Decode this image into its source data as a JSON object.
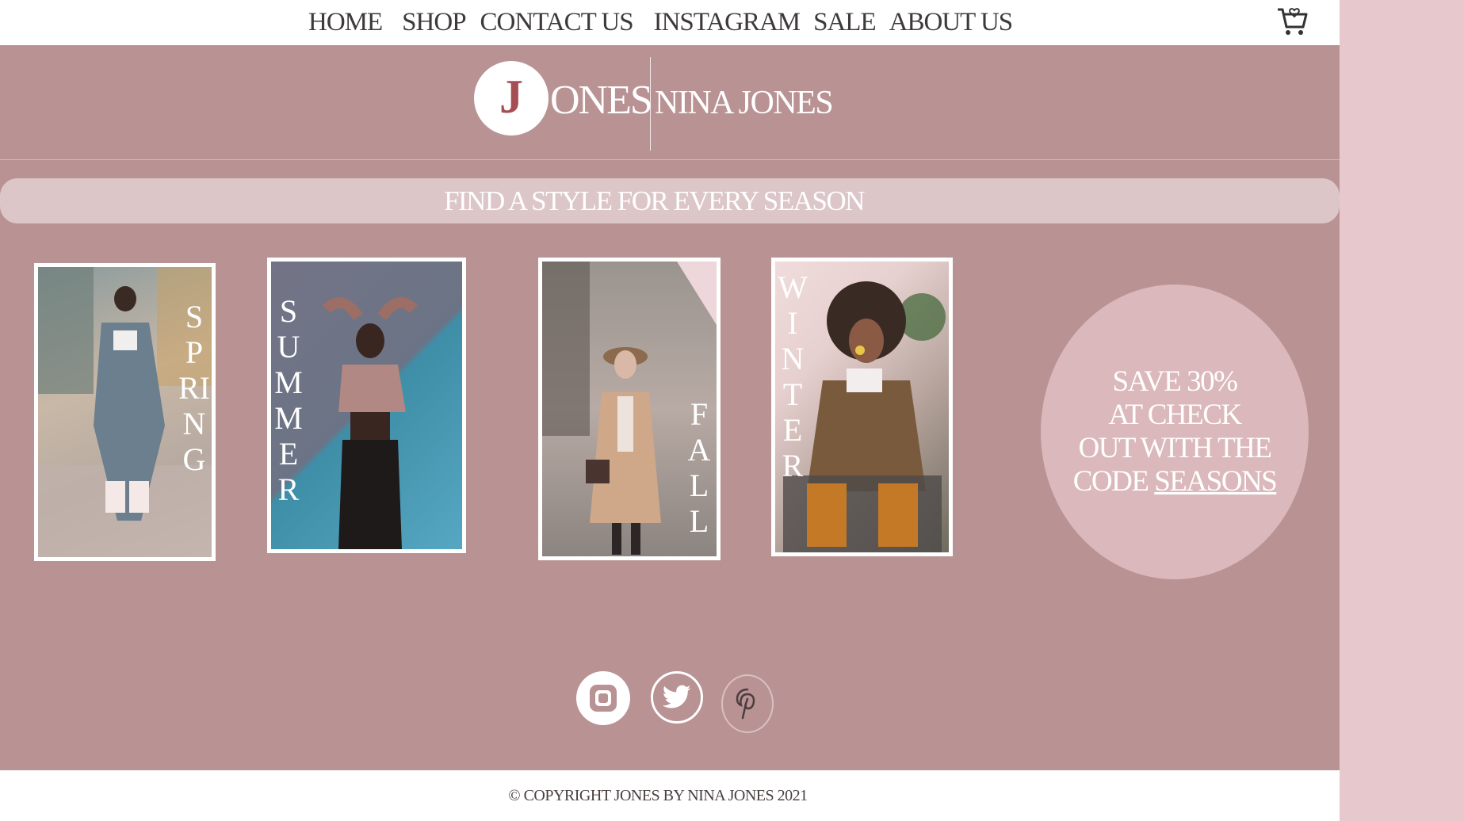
{
  "nav": {
    "items": [
      {
        "label": "HOME"
      },
      {
        "label": "SHOP"
      },
      {
        "label": "CONTACT US"
      },
      {
        "label": "INSTAGRAM"
      },
      {
        "label": "SALE"
      },
      {
        "label": "ABOUT US"
      }
    ],
    "cart_icon": "shopping-cart-icon"
  },
  "header": {
    "logo_letter": "J",
    "logo_word": "ONES",
    "brand_name": "NINA JONES"
  },
  "banner": {
    "text": "FIND A STYLE FOR EVERY SEASON"
  },
  "seasons": [
    {
      "label": "SPRING"
    },
    {
      "label": "SUMMER"
    },
    {
      "label": "FALL"
    },
    {
      "label": "WINTER"
    }
  ],
  "promo": {
    "line1": "SAVE 30%",
    "line2": "AT CHECK",
    "line3": "OUT WITH THE",
    "line4": "CODE ",
    "code": "SEASONS"
  },
  "social": [
    {
      "icon": "instagram-icon"
    },
    {
      "icon": "twitter-icon"
    },
    {
      "icon": "pinterest-icon"
    }
  ],
  "footer": {
    "copyright_symbol": "©",
    "text": "COPYRIGHT JONES BY NINA JONES 2021"
  },
  "colors": {
    "page_bg": "#b99294",
    "side_bg": "#e7c9cd",
    "banner_bg": "#dcc6c8",
    "promo_bg": "#dbb8bb",
    "logo_accent": "#a54f55"
  }
}
